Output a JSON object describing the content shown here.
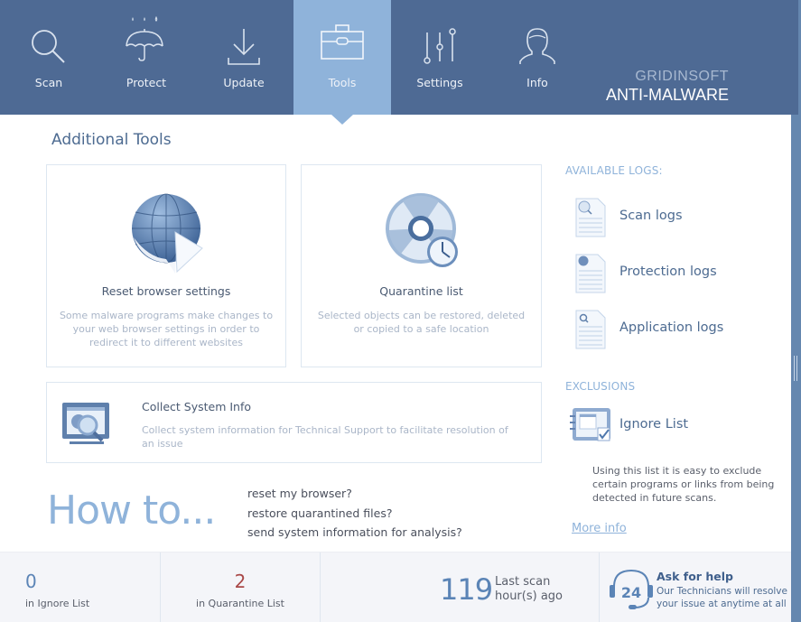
{
  "nav": {
    "items": [
      {
        "id": "scan",
        "label": "Scan",
        "icon": "search-icon"
      },
      {
        "id": "protect",
        "label": "Protect",
        "icon": "umbrella-icon"
      },
      {
        "id": "update",
        "label": "Update",
        "icon": "download-icon"
      },
      {
        "id": "tools",
        "label": "Tools",
        "icon": "toolbox-icon",
        "active": true
      },
      {
        "id": "settings",
        "label": "Settings",
        "icon": "sliders-icon"
      },
      {
        "id": "info",
        "label": "Info",
        "icon": "user-icon"
      }
    ],
    "active": "Tools"
  },
  "brand": {
    "line1": "GRIDINSOFT",
    "line2": "ANTI-MALWARE"
  },
  "page": {
    "title": "Additional Tools"
  },
  "tools": {
    "reset_browser": {
      "title": "Reset browser settings",
      "description": "Some malware programs make changes to your web browser settings in order to redirect it to different websites",
      "icon": "globe-arrow-icon"
    },
    "quarantine": {
      "title": "Quarantine list",
      "description": "Selected objects can be restored, deleted or copied to a safe location",
      "icon": "quarantine-clock-icon"
    },
    "collect_info": {
      "title": "Collect System Info",
      "description": "Collect system information for Technical Support to facilitate resolution of an issue",
      "icon": "monitor-magnifier-icon"
    }
  },
  "howto": {
    "heading": "How to...",
    "links": [
      "reset my browser?",
      "restore quarantined files?",
      "send system information for analysis?"
    ]
  },
  "logs": {
    "heading": "AVAILABLE LOGS:",
    "items": [
      {
        "label": "Scan logs",
        "icon": "scan-log-icon"
      },
      {
        "label": "Protection logs",
        "icon": "protection-log-icon"
      },
      {
        "label": "Application logs",
        "icon": "application-log-icon"
      }
    ]
  },
  "exclusions": {
    "heading": "EXCLUSIONS",
    "ignore_list": {
      "label": "Ignore List",
      "icon": "ignore-list-icon"
    },
    "description": "Using this list it is easy to exclude certain programs or links from being detected in future scans.",
    "more_info": "More info"
  },
  "status": {
    "ignore": {
      "count": "0",
      "caption": "in Ignore List"
    },
    "quarantine": {
      "count": "2",
      "caption": "in Quarantine List"
    },
    "last_scan": {
      "value": "119",
      "line1": "Last scan",
      "line2": "hour(s) ago"
    },
    "help": {
      "title": "Ask for help",
      "description": "Our Technicians will resolve your issue at anytime at all",
      "badge": "24"
    }
  },
  "colors": {
    "nav_bg": "#4e6a94",
    "nav_active": "#8fb3da",
    "accent_light": "#8fb3da",
    "quarantine_count": "#a94848",
    "count_blue": "#5b84b6"
  }
}
